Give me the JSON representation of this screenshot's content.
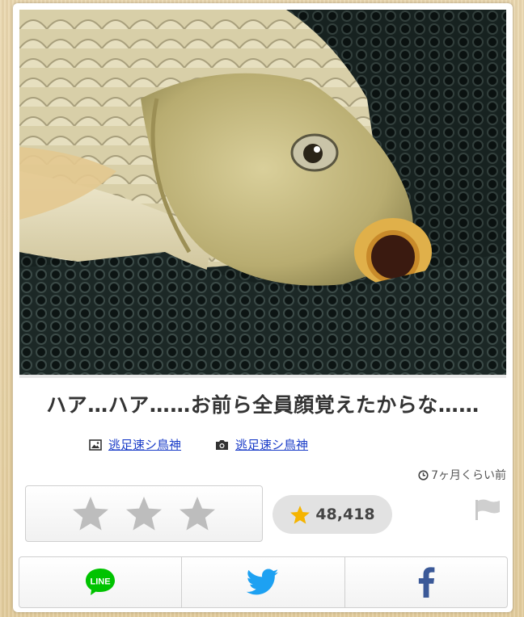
{
  "post": {
    "title": "ハア…ハア……お前ら全員顔覚えたからな……",
    "image_credit": "逃足速シ鳥神",
    "photo_credit": "逃足速シ鳥神",
    "time_ago": "7ヶ月くらい前"
  },
  "rating": {
    "stars": 3,
    "score": "48,418"
  },
  "share": {
    "line_label": "LINE"
  },
  "icons": {
    "image": "image-icon",
    "camera": "camera-icon",
    "clock": "clock-icon",
    "star": "star-icon",
    "flag": "flag-icon",
    "line": "line-icon",
    "twitter": "twitter-icon",
    "facebook": "facebook-icon"
  },
  "colors": {
    "link": "#1a3cc8",
    "star_gold": "#f5b400",
    "line_green": "#00c300",
    "twitter_blue": "#1da1f2",
    "facebook_blue": "#3b5998"
  }
}
